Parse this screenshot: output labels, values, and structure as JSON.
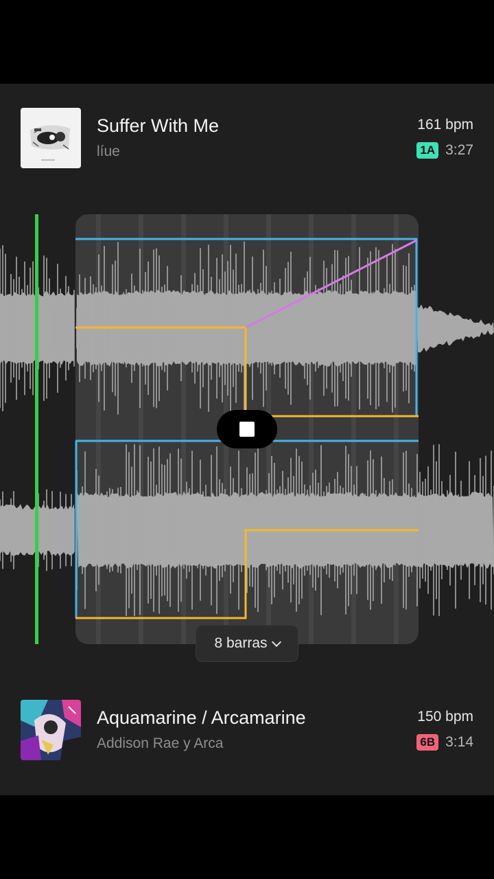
{
  "deck_a": {
    "title": "Suffer With Me",
    "artist": "líue",
    "bpm": "161 bpm",
    "key": "1A",
    "key_color": "#3ee0b8",
    "duration": "3:27"
  },
  "deck_b": {
    "title": "Aquamarine / Arcamarine",
    "artist": "Addison Rae y Arca",
    "bpm": "150 bpm",
    "key": "6B",
    "key_color": "#f0637a",
    "duration": "3:14"
  },
  "transition": {
    "length_label": "8 barras"
  },
  "colors": {
    "playhead": "#35d04a",
    "volume_line": "#47b2e8",
    "eq_line": "#f4b82a",
    "filter_line": "#d57ae6",
    "waveform": "#a9a9a9"
  }
}
